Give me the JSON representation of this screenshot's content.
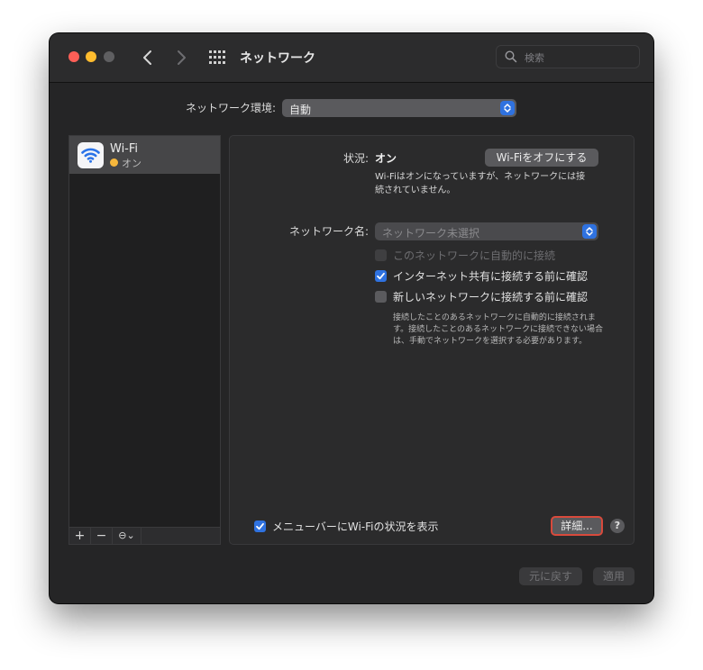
{
  "window": {
    "title": "ネットワーク",
    "search_placeholder": "検索"
  },
  "location": {
    "label": "ネットワーク環境:",
    "value": "自動"
  },
  "sidebar": {
    "items": [
      {
        "name": "Wi-Fi",
        "status": "オン",
        "status_color": "#f6b73c",
        "icon": "wifi-icon"
      }
    ],
    "toolbar": {
      "add": "+",
      "remove": "−",
      "action": "⊖⌄"
    }
  },
  "panel": {
    "status_label": "状況:",
    "status_value": "オン",
    "wifi_off_button": "Wi-Fiをオフにする",
    "status_desc_1": "Wi-Fiはオンになっていますが、ネットワークには接",
    "status_desc_2": "続されていません。",
    "network_name_label": "ネットワーク名:",
    "network_name_placeholder": "ネットワーク未選択",
    "checkboxes": [
      {
        "label": "このネットワークに自動的に接続",
        "checked": false,
        "disabled": true
      },
      {
        "label": "インターネット共有に接続する前に確認",
        "checked": true,
        "disabled": false
      },
      {
        "label": "新しいネットワークに接続する前に確認",
        "checked": false,
        "disabled": false
      }
    ],
    "note_1": "接続したことのあるネットワークに自動的に接続されま",
    "note_2": "す。接続したことのあるネットワークに接続できない場合",
    "note_3": "は、手動でネットワークを選択する必要があります。",
    "menubar_label": "メニューバーにWi-Fiの状況を表示",
    "menubar_checked": true,
    "details_button": "詳細...",
    "help": "?"
  },
  "footer": {
    "revert": "元に戻す",
    "apply": "適用"
  },
  "colors": {
    "accent": "#2f72e0",
    "highlight_border": "#d84a3c"
  }
}
